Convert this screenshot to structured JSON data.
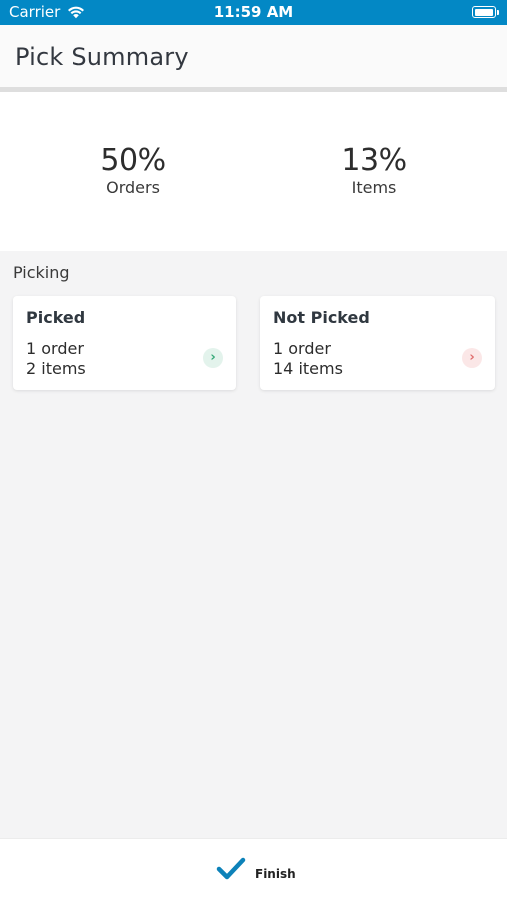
{
  "status_bar": {
    "carrier": "Carrier",
    "time": "11:59 AM",
    "icons": [
      "wifi-icon",
      "battery-icon"
    ]
  },
  "header": {
    "title": "Pick Summary"
  },
  "stats": [
    {
      "value": "50%",
      "label": "Orders"
    },
    {
      "value": "13%",
      "label": "Items"
    }
  ],
  "picking": {
    "section_label": "Picking",
    "cards": [
      {
        "title": "Picked",
        "line1": "1 order",
        "line2": "2 items",
        "icon": "chevron-right-icon",
        "accent": "#35a877"
      },
      {
        "title": "Not Picked",
        "line1": "1 order",
        "line2": "14 items",
        "icon": "chevron-right-icon",
        "accent": "#e06c6c"
      }
    ]
  },
  "footer": {
    "finish_label": "Finish",
    "icon": "checkmark-icon",
    "accent": "#0d82b9"
  },
  "colors": {
    "status_bar": "#0388c5",
    "background": "#f4f4f5"
  }
}
